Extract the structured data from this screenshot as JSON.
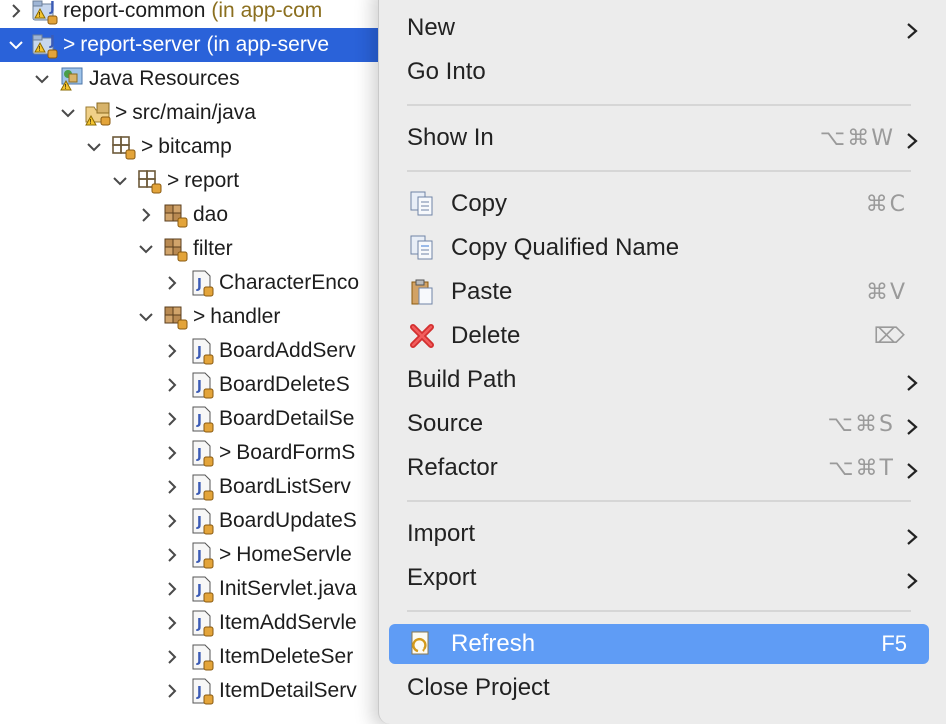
{
  "tree": {
    "rows": [
      {
        "indent": 0,
        "expanded": false,
        "icon": "java-project-icon",
        "dirty": "",
        "label": "report-common",
        "suffix": "(in app-com"
      },
      {
        "indent": 0,
        "expanded": true,
        "icon": "java-project-icon",
        "dirty": ">",
        "label": "report-server",
        "suffix": "(in app-serve",
        "selected": true
      },
      {
        "indent": 1,
        "expanded": true,
        "icon": "library-container-icon",
        "dirty": "",
        "label": "Java Resources",
        "suffix": ""
      },
      {
        "indent": 2,
        "expanded": true,
        "icon": "source-folder-icon",
        "dirty": ">",
        "label": "src/main/java",
        "suffix": ""
      },
      {
        "indent": 3,
        "expanded": true,
        "icon": "package-icon",
        "dirty": ">",
        "label": "bitcamp",
        "suffix": ""
      },
      {
        "indent": 4,
        "expanded": true,
        "icon": "package-icon",
        "dirty": ">",
        "label": "report",
        "suffix": ""
      },
      {
        "indent": 5,
        "expanded": false,
        "icon": "package-filled-icon",
        "dirty": "",
        "label": "dao",
        "suffix": ""
      },
      {
        "indent": 5,
        "expanded": true,
        "icon": "package-filled-icon",
        "dirty": "",
        "label": "filter",
        "suffix": ""
      },
      {
        "indent": 6,
        "expanded": false,
        "icon": "java-file-icon",
        "dirty": "",
        "label": "CharacterEnco",
        "suffix": ""
      },
      {
        "indent": 5,
        "expanded": true,
        "icon": "package-filled-icon",
        "dirty": ">",
        "label": "handler",
        "suffix": ""
      },
      {
        "indent": 6,
        "expanded": false,
        "icon": "java-file-icon",
        "dirty": "",
        "label": "BoardAddServ",
        "suffix": ""
      },
      {
        "indent": 6,
        "expanded": false,
        "icon": "java-file-icon",
        "dirty": "",
        "label": "BoardDeleteS",
        "suffix": ""
      },
      {
        "indent": 6,
        "expanded": false,
        "icon": "java-file-icon",
        "dirty": "",
        "label": "BoardDetailSe",
        "suffix": ""
      },
      {
        "indent": 6,
        "expanded": false,
        "icon": "java-file-icon",
        "dirty": ">",
        "label": "BoardFormS",
        "suffix": ""
      },
      {
        "indent": 6,
        "expanded": false,
        "icon": "java-file-icon",
        "dirty": "",
        "label": "BoardListServ",
        "suffix": ""
      },
      {
        "indent": 6,
        "expanded": false,
        "icon": "java-file-icon",
        "dirty": "",
        "label": "BoardUpdateS",
        "suffix": ""
      },
      {
        "indent": 6,
        "expanded": false,
        "icon": "java-file-icon",
        "dirty": ">",
        "label": "HomeServle",
        "suffix": ""
      },
      {
        "indent": 6,
        "expanded": false,
        "icon": "java-file-icon",
        "dirty": "",
        "label": "InitServlet.java",
        "suffix": ""
      },
      {
        "indent": 6,
        "expanded": false,
        "icon": "java-file-icon",
        "dirty": "",
        "label": "ItemAddServle",
        "suffix": ""
      },
      {
        "indent": 6,
        "expanded": false,
        "icon": "java-file-icon",
        "dirty": "",
        "label": "ItemDeleteSer",
        "suffix": ""
      },
      {
        "indent": 6,
        "expanded": false,
        "icon": "java-file-icon",
        "dirty": "",
        "label": "ItemDetailServ",
        "suffix": ""
      }
    ]
  },
  "menu": {
    "items": [
      {
        "id": "new",
        "label": "New",
        "shortcut": "",
        "submenu": true,
        "icon": ""
      },
      {
        "id": "go-into",
        "label": "Go Into",
        "shortcut": "",
        "submenu": false,
        "icon": ""
      },
      {
        "id": "show-in",
        "label": "Show In",
        "shortcut": "⌥⌘W",
        "submenu": true,
        "icon": ""
      },
      {
        "id": "copy",
        "label": "Copy",
        "shortcut": "⌘C",
        "submenu": false,
        "icon": "copy-icon"
      },
      {
        "id": "copy-qualified-name",
        "label": "Copy Qualified Name",
        "shortcut": "",
        "submenu": false,
        "icon": "copy-qualified-name-icon"
      },
      {
        "id": "paste",
        "label": "Paste",
        "shortcut": "⌘V",
        "submenu": false,
        "icon": "paste-icon"
      },
      {
        "id": "delete",
        "label": "Delete",
        "shortcut": "⌦",
        "submenu": false,
        "icon": "delete-icon"
      },
      {
        "id": "build-path",
        "label": "Build Path",
        "shortcut": "",
        "submenu": true,
        "icon": ""
      },
      {
        "id": "source",
        "label": "Source",
        "shortcut": "⌥⌘S",
        "submenu": true,
        "icon": ""
      },
      {
        "id": "refactor",
        "label": "Refactor",
        "shortcut": "⌥⌘T",
        "submenu": true,
        "icon": ""
      },
      {
        "id": "import",
        "label": "Import",
        "shortcut": "",
        "submenu": true,
        "icon": ""
      },
      {
        "id": "export",
        "label": "Export",
        "shortcut": "",
        "submenu": true,
        "icon": ""
      },
      {
        "id": "refresh",
        "label": "Refresh",
        "shortcut": "F5",
        "submenu": false,
        "icon": "refresh-icon",
        "active": true
      },
      {
        "id": "close-project",
        "label": "Close Project",
        "shortcut": "",
        "submenu": false,
        "icon": ""
      }
    ]
  },
  "colors": {
    "selection": "#2a62d9",
    "menu_background": "#ececec",
    "menu_highlight": "#5f9cf5",
    "project_suffix": "#8b6f1f"
  }
}
